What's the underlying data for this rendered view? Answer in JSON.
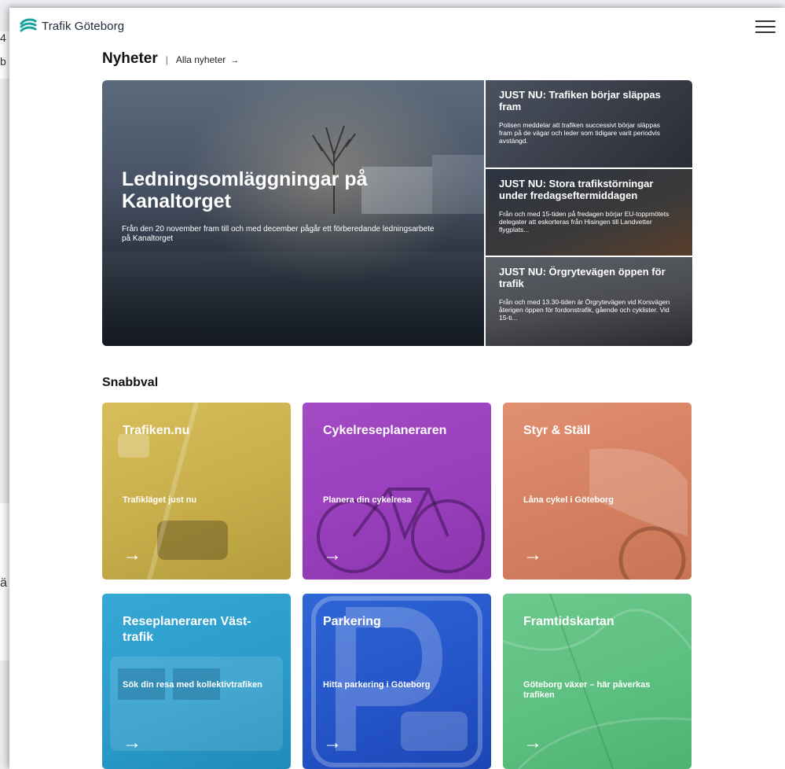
{
  "background": {
    "left_text_1": "4",
    "left_text_2": "b",
    "left_text_3": "ä"
  },
  "header": {
    "logo_text": "Trafik Göteborg",
    "menu_icon": "hamburger-menu-icon"
  },
  "news": {
    "title": "Nyheter",
    "separator": "|",
    "all_link": "Alla nyheter",
    "all_arrow": "→",
    "hero": {
      "title": "Ledningsomläggningar på Kanaltorget",
      "description": "Från den 20 november fram till och med december pågår ett förberedande ledningsarbete på Kanaltorget"
    },
    "side": [
      {
        "title": "JUST NU: Trafiken börjar släppas fram",
        "text": "Polisen meddelar att trafiken successivt börjar släppas fram på de vägar och leder som tidigare varit periodvis avstängd."
      },
      {
        "title": "JUST NU: Stora trafikstörningar under fredagseftermiddagen",
        "text": "Från och med 15-tiden på fredagen börjar EU-toppmötets delegater att eskorteras från Hisingen till Landvetter flygplats..."
      },
      {
        "title": "JUST NU: Örgrytevägen öppen för trafik",
        "text": "Från och med 13.30-tiden är Örgrytevägen vid Korsvägen återigen öppen för fordonstrafik, gående och cyklister. Vid 15-ti..."
      }
    ]
  },
  "quick": {
    "title": "Snabbval",
    "tiles": [
      {
        "title": "Trafiken.nu",
        "subtitle": "Trafikläget just nu",
        "arrow": "→",
        "color": "#cdb44f"
      },
      {
        "title": "Cykelreseplaneraren",
        "subtitle": "Planera din cykelresa",
        "arrow": "→",
        "color": "#9b40bd"
      },
      {
        "title": "Styr & Ställ",
        "subtitle": "Låna cykel i Göteborg",
        "arrow": "→",
        "color": "#d58162"
      },
      {
        "title": "Reseplaneraren Väst-trafik",
        "subtitle": "Sök din resa med kollektivtrafiken",
        "arrow": "→",
        "color": "#2b9cca"
      },
      {
        "title": "Parkering",
        "subtitle": "Hitta parkering i Göteborg",
        "arrow": "→",
        "color": "#2455c9"
      },
      {
        "title": "Framtidskartan",
        "subtitle": "Göteborg växer – här påverkas trafiken",
        "arrow": "→",
        "color": "#5dbf80"
      }
    ]
  }
}
